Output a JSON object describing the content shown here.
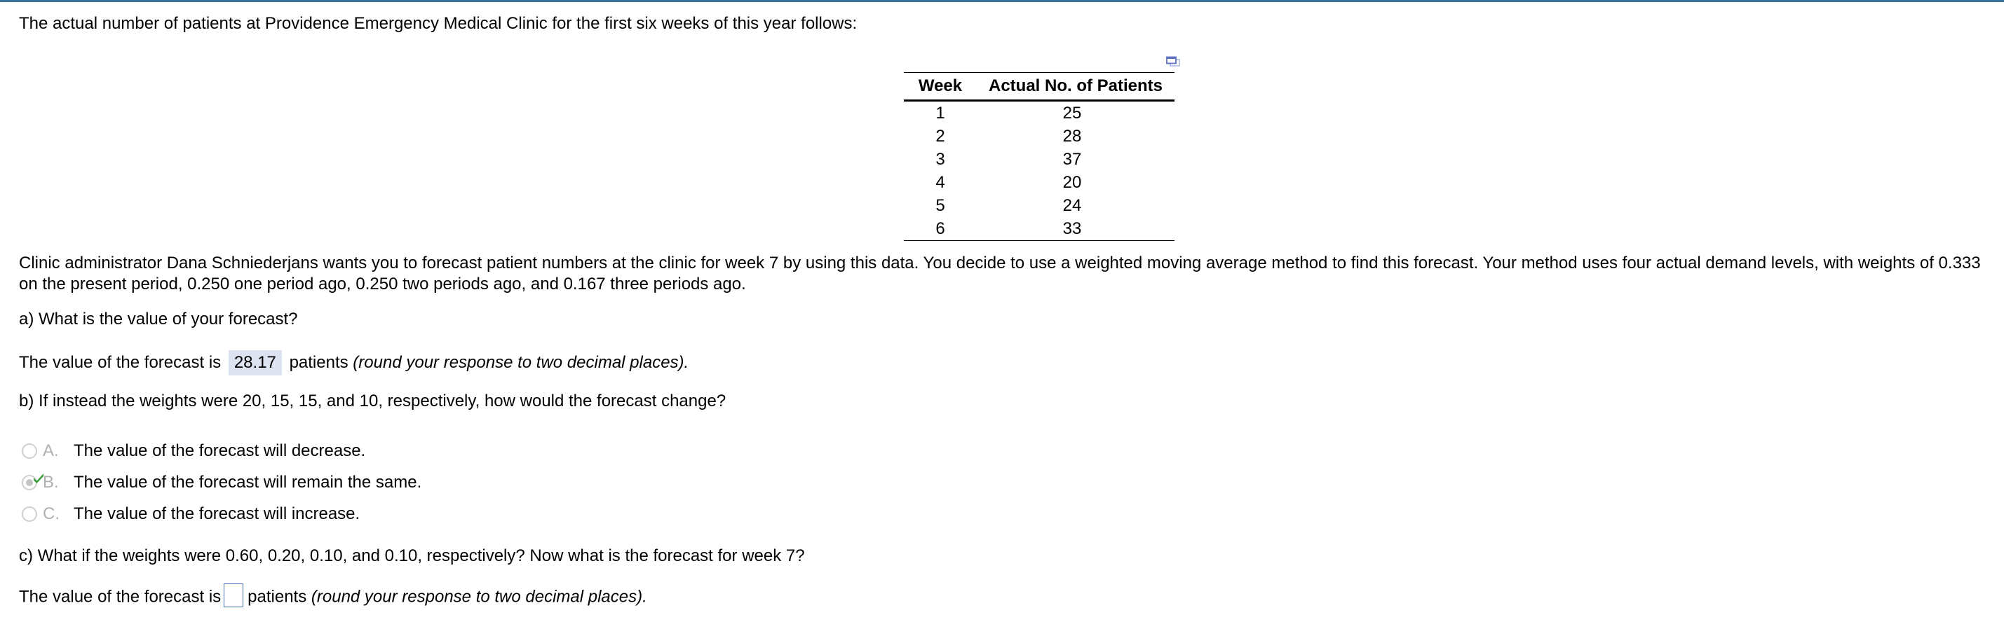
{
  "intro": "The actual number of patients at Providence Emergency Medical Clinic for the first six weeks of this year follows:",
  "table": {
    "headers": [
      "Week",
      "Actual No. of Patients"
    ],
    "rows": [
      [
        "1",
        "25"
      ],
      [
        "2",
        "28"
      ],
      [
        "3",
        "37"
      ],
      [
        "4",
        "20"
      ],
      [
        "5",
        "24"
      ],
      [
        "6",
        "33"
      ]
    ],
    "popout_icon": "popout-window-icon"
  },
  "scenario": "Clinic administrator Dana Schniederjans wants you to forecast patient numbers at the clinic for week 7 by using this data. You decide to use a weighted moving average method to find this forecast. Your method uses four actual demand levels, with weights of 0.333 on the present period, 0.250 one period ago, 0.250 two periods ago, and 0.167 three periods ago.",
  "part_a": {
    "question": "a) What is the value of your forecast?",
    "prefix": "The value of the forecast is",
    "answer": "28.17",
    "suffix": "patients",
    "hint": "(round your response to two decimal places)."
  },
  "part_b": {
    "question": "b) If instead the weights were 20, 15, 15, and 10, respectively, how would the forecast change?",
    "options": [
      {
        "letter": "A.",
        "text": "The value of the forecast will decrease.",
        "selected": false
      },
      {
        "letter": "B.",
        "text": "The value of the forecast will remain the same.",
        "selected": true
      },
      {
        "letter": "C.",
        "text": "The value of the forecast will increase.",
        "selected": false
      }
    ],
    "correct_icon": "checkmark-icon",
    "check_color": "#3a9c3a"
  },
  "part_c": {
    "question": "c) What if the weights were 0.60, 0.20, 0.10, and 0.10, respectively? Now what is the forecast for week 7?",
    "prefix": "The value of the forecast is",
    "answer": "",
    "suffix": "patients",
    "hint": "(round your response to two decimal places)."
  },
  "colors": {
    "topbar": "#3a7399",
    "answer_bg": "#dde3f0",
    "input_border": "#4a6fbd"
  }
}
